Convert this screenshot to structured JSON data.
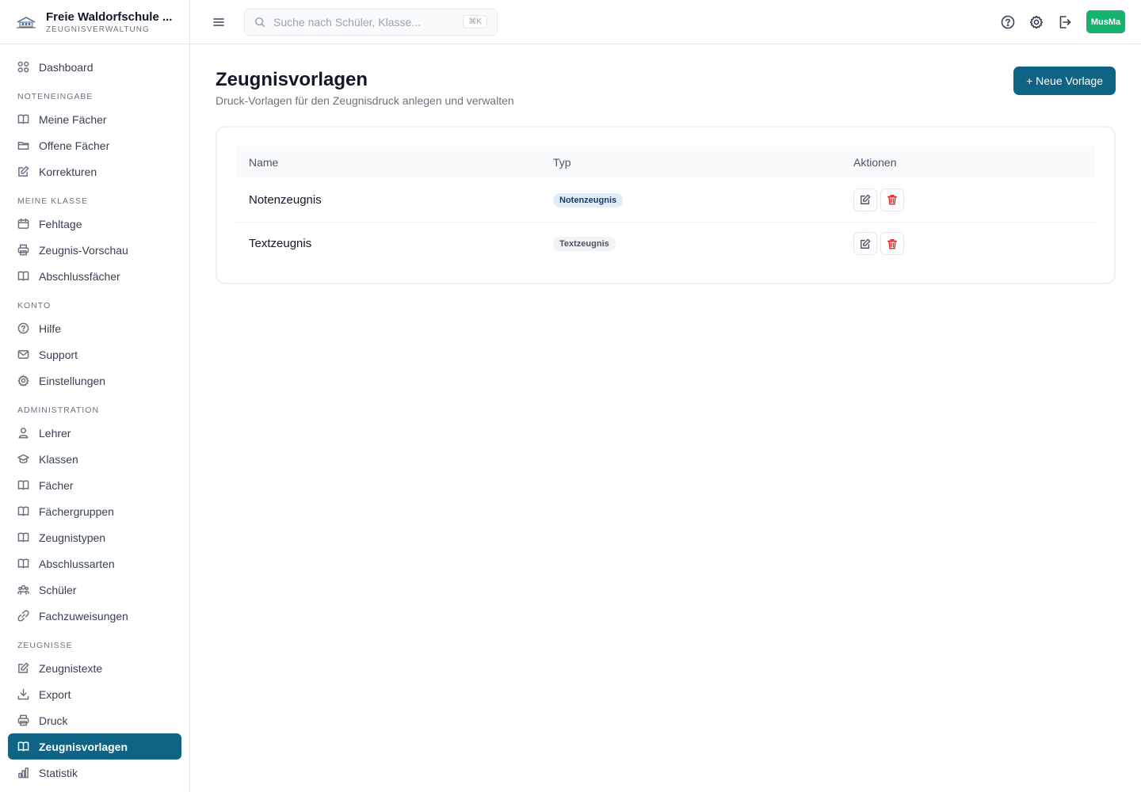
{
  "brand": {
    "title": "Freie Waldorfschule ...",
    "subtitle": "ZEUGNISVERWALTUNG"
  },
  "search": {
    "placeholder": "Suche nach Schüler, Klasse...",
    "shortcut": "⌘K"
  },
  "user": {
    "initials": "MusMa"
  },
  "sidebar": {
    "dashboard": "Dashboard",
    "sections": {
      "noteneingabe": "NOTENEINGABE",
      "meine_klasse": "MEINE KLASSE",
      "konto": "KONTO",
      "administration": "ADMINISTRATION",
      "zeugnisse": "ZEUGNISSE"
    },
    "items": {
      "meine_faecher": "Meine Fächer",
      "offene_faecher": "Offene Fächer",
      "korrekturen": "Korrekturen",
      "fehltage": "Fehltage",
      "zeugnis_vorschau": "Zeugnis-Vorschau",
      "abschlussfaecher": "Abschlussfächer",
      "hilfe": "Hilfe",
      "support": "Support",
      "einstellungen": "Einstellungen",
      "lehrer": "Lehrer",
      "klassen": "Klassen",
      "faecher": "Fächer",
      "faechergruppen": "Fächergruppen",
      "zeugnistypen": "Zeugnistypen",
      "abschlussarten": "Abschlussarten",
      "schueler": "Schüler",
      "fachzuweisungen": "Fachzuweisungen",
      "zeugnistexte": "Zeugnistexte",
      "export": "Export",
      "druck": "Druck",
      "zeugnisvorlagen": "Zeugnisvorlagen",
      "statistik": "Statistik"
    },
    "active": "zeugnisvorlagen"
  },
  "page": {
    "title": "Zeugnisvorlagen",
    "subtitle": "Druck-Vorlagen für den Zeugnisdruck anlegen und verwalten",
    "new_button": "+ Neue Vorlage"
  },
  "table": {
    "columns": [
      "Name",
      "Typ",
      "Aktionen"
    ],
    "rows": [
      {
        "name": "Notenzeugnis",
        "type": "Notenzeugnis"
      },
      {
        "name": "Textzeugnis",
        "type": "Textzeugnis"
      }
    ]
  },
  "colors": {
    "accent": "#0f6485",
    "avatar": "#16b36e",
    "danger": "#dc2626"
  }
}
